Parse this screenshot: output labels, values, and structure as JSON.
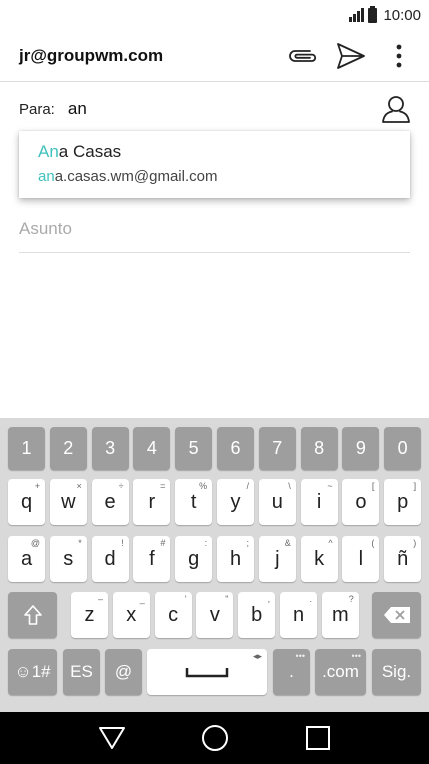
{
  "status_bar": {
    "time": "10:00"
  },
  "app_bar": {
    "account": "jr@groupwm.com"
  },
  "compose": {
    "to_label": "Para:",
    "to_value": "an",
    "subject_placeholder": "Asunto"
  },
  "suggestion": {
    "name_highlight": "An",
    "name_rest": "a Casas",
    "email_highlight": "an",
    "email_rest": "a.casas.wm@gmail.com"
  },
  "keyboard": {
    "row1": [
      "1",
      "2",
      "3",
      "4",
      "5",
      "6",
      "7",
      "8",
      "9",
      "0"
    ],
    "row2": [
      {
        "k": "q",
        "h": "+"
      },
      {
        "k": "w",
        "h": "×"
      },
      {
        "k": "e",
        "h": "÷"
      },
      {
        "k": "r",
        "h": "="
      },
      {
        "k": "t",
        "h": "%"
      },
      {
        "k": "y",
        "h": "/"
      },
      {
        "k": "u",
        "h": "\\"
      },
      {
        "k": "i",
        "h": "~"
      },
      {
        "k": "o",
        "h": "["
      },
      {
        "k": "p",
        "h": "]"
      }
    ],
    "row3": [
      {
        "k": "a",
        "h": "@"
      },
      {
        "k": "s",
        "h": "*"
      },
      {
        "k": "d",
        "h": "!"
      },
      {
        "k": "f",
        "h": "#"
      },
      {
        "k": "g",
        "h": ":"
      },
      {
        "k": "h",
        "h": ";"
      },
      {
        "k": "j",
        "h": "&"
      },
      {
        "k": "k",
        "h": "^"
      },
      {
        "k": "l",
        "h": "("
      },
      {
        "k": "ñ",
        "h": ")"
      }
    ],
    "row4": [
      {
        "k": "z",
        "h": "–"
      },
      {
        "k": "x",
        "h": "_"
      },
      {
        "k": "c",
        "h": "'"
      },
      {
        "k": "v",
        "h": "\""
      },
      {
        "k": "b",
        "h": ","
      },
      {
        "k": "n",
        "h": "."
      },
      {
        "k": "m",
        "h": "?"
      }
    ],
    "symbols_label": "☺1#",
    "lang_label": "ES",
    "at_label": "@",
    "dot_label": ".",
    "dotcom_label": ".com",
    "next_label": "Sig."
  },
  "colors": {
    "highlight": "#3fc2bd",
    "keyboard_bg": "#d9d9d9",
    "gray_key": "#9e9e9e"
  }
}
